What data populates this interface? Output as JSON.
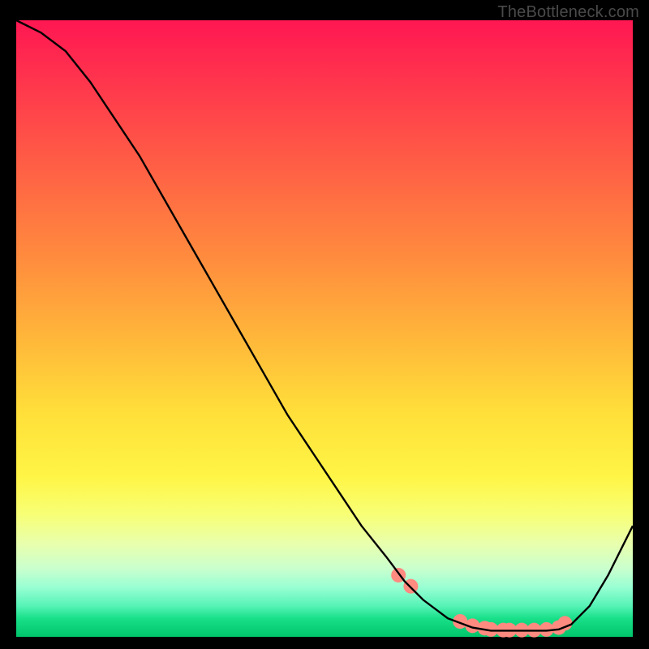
{
  "watermark": "TheBottleneck.com",
  "chart_data": {
    "type": "line",
    "title": "",
    "xlabel": "",
    "ylabel": "",
    "xlim": [
      0,
      100
    ],
    "ylim": [
      0,
      100
    ],
    "grid": false,
    "legend": false,
    "series": [
      {
        "name": "bottleneck-curve",
        "color": "#000000",
        "x": [
          0,
          4,
          8,
          12,
          16,
          20,
          24,
          28,
          32,
          36,
          40,
          44,
          48,
          52,
          56,
          60,
          63,
          66,
          70,
          74,
          77,
          80,
          83,
          86,
          88,
          90,
          93,
          96,
          100
        ],
        "y": [
          100,
          98,
          95,
          90,
          84,
          78,
          71,
          64,
          57,
          50,
          43,
          36,
          30,
          24,
          18,
          13,
          9,
          6,
          3,
          1.5,
          1,
          1,
          1,
          1,
          1.2,
          2,
          5,
          10,
          18
        ]
      }
    ],
    "markers": {
      "name": "highlight-dots",
      "color": "#ff8a80",
      "radius_px": 9,
      "x": [
        62,
        64,
        72,
        74,
        76,
        77,
        79,
        80,
        82,
        84,
        86,
        88,
        89
      ],
      "y": [
        10,
        8.2,
        2.5,
        1.8,
        1.4,
        1.2,
        1.1,
        1.1,
        1.1,
        1.1,
        1.2,
        1.5,
        2.2
      ]
    }
  }
}
